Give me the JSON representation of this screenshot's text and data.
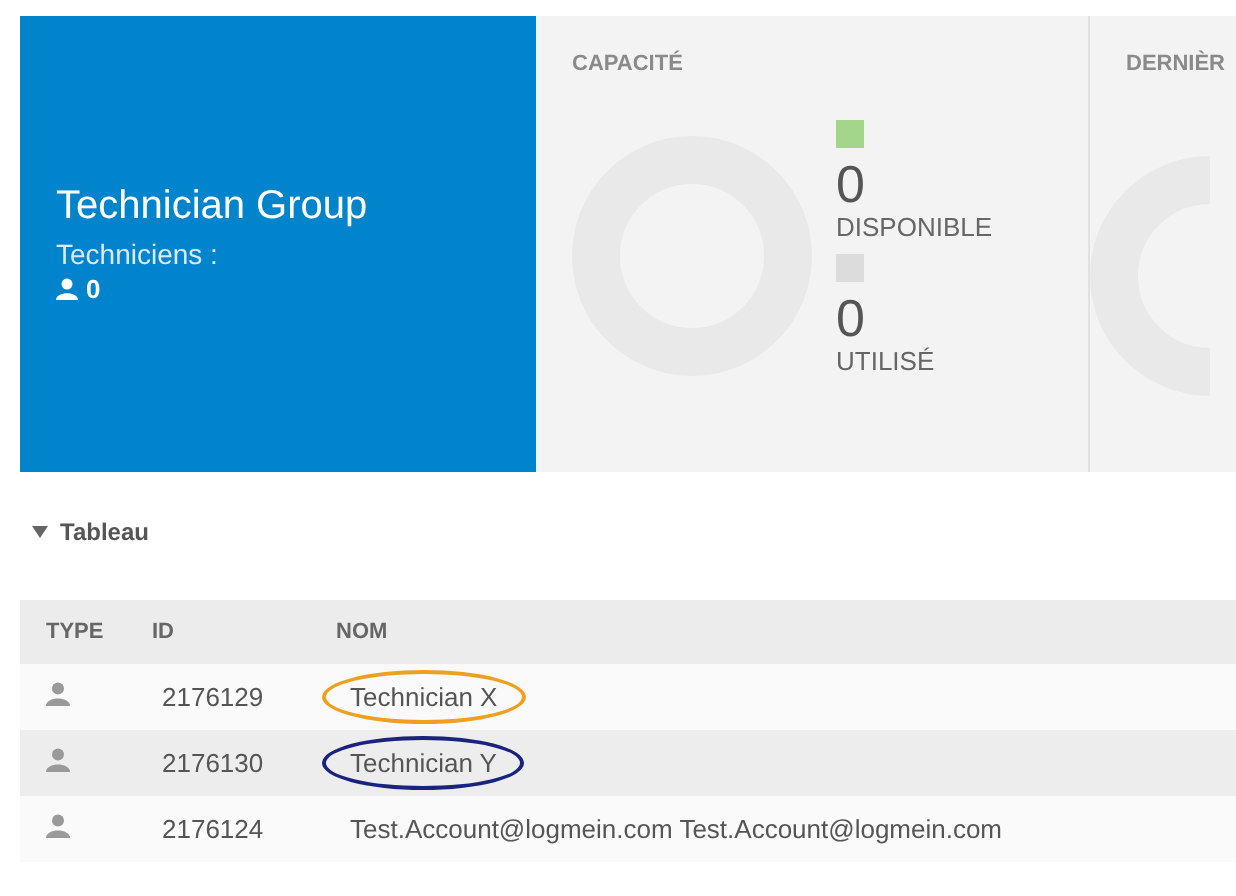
{
  "group": {
    "title": "Technician Group",
    "subtitle": "Techniciens :",
    "count": "0"
  },
  "capacity": {
    "heading": "CAPACITÉ",
    "legend": [
      {
        "color": "#a3d58a",
        "value": "0",
        "label": "DISPONIBLE"
      },
      {
        "color": "#dcdcdc",
        "value": "0",
        "label": "UTILISÉ"
      }
    ]
  },
  "last_panel": {
    "heading": "DERNIÈR"
  },
  "section": {
    "title": "Tableau",
    "expanded": true
  },
  "table": {
    "columns": [
      "TYPE",
      "ID",
      "NOM"
    ],
    "rows": [
      {
        "id": "2176129",
        "name": "Technician X",
        "color": "#f0a020"
      },
      {
        "id": "2176130",
        "name": "Technician Y",
        "color": "#1a237e"
      },
      {
        "id": "2176124",
        "name": "Test.Account@logmein.com Test.Account@logmein.com"
      }
    ]
  }
}
